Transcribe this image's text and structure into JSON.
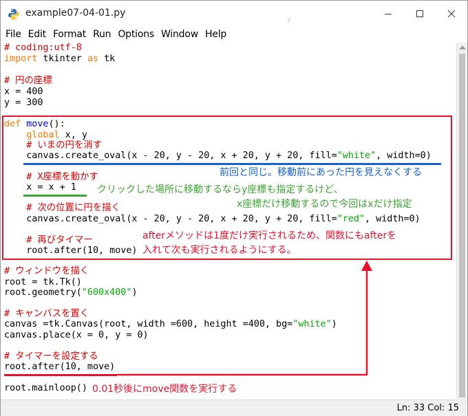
{
  "window": {
    "title": "example07-04-01.py",
    "title_ghost": "y",
    "controls": {
      "minimize": "minimize",
      "maximize": "maximize",
      "close": "close"
    }
  },
  "menu": {
    "items": [
      "File",
      "Edit",
      "Format",
      "Run",
      "Options",
      "Window",
      "Help"
    ]
  },
  "code": {
    "l1": "# coding:utf-8",
    "l2_kw": "import",
    "l2_mid": " tkinter ",
    "l2_as": "as",
    "l2_end": " tk",
    "l4": "# 円の座標",
    "l5": "x = 400",
    "l6": "y = 300",
    "l8_def": "def",
    "l8_sp": " ",
    "l8_fn": "move",
    "l8_end": "():",
    "l9_indent": "    ",
    "l9_kw": "global",
    "l9_end": " x, y",
    "l10": "    # いまの円を消す",
    "l11_a": "    canvas.create_oval(x - 20, y - 20, x + 20, y + 20, fill=",
    "l11_str": "\"white\"",
    "l11_b": ", width=0)",
    "l13": "    # X座標を動かす",
    "l14": "    x = x + 1",
    "l16": "    # 次の位置に円を描く",
    "l17_a": "    canvas.create_oval(x - 20, y - 20, x + 20, y + 20, fill=",
    "l17_str": "\"red\"",
    "l17_b": ", width=0)",
    "l19": "    # 再びタイマー",
    "l20": "    root.after(10, move)",
    "l21": "# ウィンドウを描く",
    "l22": "root = tk.Tk()",
    "l23_a": "root.geometry(",
    "l23_str": "\"600x400\"",
    "l23_b": ")",
    "l25": "# キャンバスを置く",
    "l26_a": "canvas =tk.Canvas(root, width =600, height =400, bg=",
    "l26_str": "\"white\"",
    "l26_b": ")",
    "l27": "canvas.place(x = 0, y = 0)",
    "l29": "# タイマーを設定する",
    "l30": "root.after(10, move)",
    "l32": "root.mainloop()"
  },
  "annotations": {
    "blue_note": "前回と同じ。移動前にあった円を見えなくする",
    "green_note_1": "クリックした場所に移動するならy座標も指定するけど、",
    "green_note_2": "x座標だけ移動するので今回はxだけ指定",
    "red_note_1": "afterメソッドは1度だけ実行されるため、関数にもafterを",
    "red_note_2": "入れて次も実行されるようにする。",
    "red_note_3": "0.01秒後にmove関数を実行する",
    "colors": {
      "red": "#e8112d",
      "blue": "#1560d8",
      "green": "#3aa52f"
    }
  },
  "status": {
    "position": "Ln: 33  Col: 15"
  }
}
